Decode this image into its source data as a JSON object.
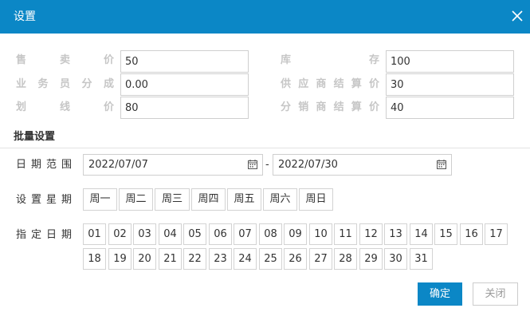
{
  "dialog": {
    "title": "设置",
    "close_icon": "close-icon"
  },
  "prices": {
    "sale_price": {
      "label": [
        "售",
        "卖",
        "价"
      ],
      "value": "50"
    },
    "inventory": {
      "label": [
        "库",
        "存"
      ],
      "value": "100"
    },
    "salesman_share": {
      "label": [
        "业",
        "务",
        "员",
        "分",
        "成"
      ],
      "value": "0.00"
    },
    "supplier_settle": {
      "label": [
        "供",
        "应",
        "商",
        "结",
        "算",
        "价"
      ],
      "value": "30"
    },
    "line_price": {
      "label": [
        "划",
        "线",
        "价"
      ],
      "value": "80"
    },
    "distributor_settle": {
      "label": [
        "分",
        "销",
        "商",
        "结",
        "算",
        "价"
      ],
      "value": "40"
    }
  },
  "batch": {
    "title": "批量设置",
    "date_range_label": "日期范围",
    "start_date": "2022/07/07",
    "end_date": "2022/07/30",
    "separator": "-",
    "calendar_icon": "calendar-icon",
    "weekdays_label": "设置星期",
    "weekdays": [
      "周一",
      "周二",
      "周三",
      "周四",
      "周五",
      "周六",
      "周日"
    ],
    "days_label": "指定日期",
    "days": [
      "01",
      "02",
      "03",
      "04",
      "05",
      "06",
      "07",
      "08",
      "09",
      "10",
      "11",
      "12",
      "13",
      "14",
      "15",
      "16",
      "17",
      "18",
      "19",
      "20",
      "21",
      "22",
      "23",
      "24",
      "25",
      "26",
      "27",
      "28",
      "29",
      "30",
      "31"
    ]
  },
  "buttons": {
    "ok": "确定",
    "cancel": "关闭"
  },
  "colors": {
    "accent": "#0b87c6",
    "muted_label": "#c6c6c6",
    "border": "#cfcfcf"
  }
}
